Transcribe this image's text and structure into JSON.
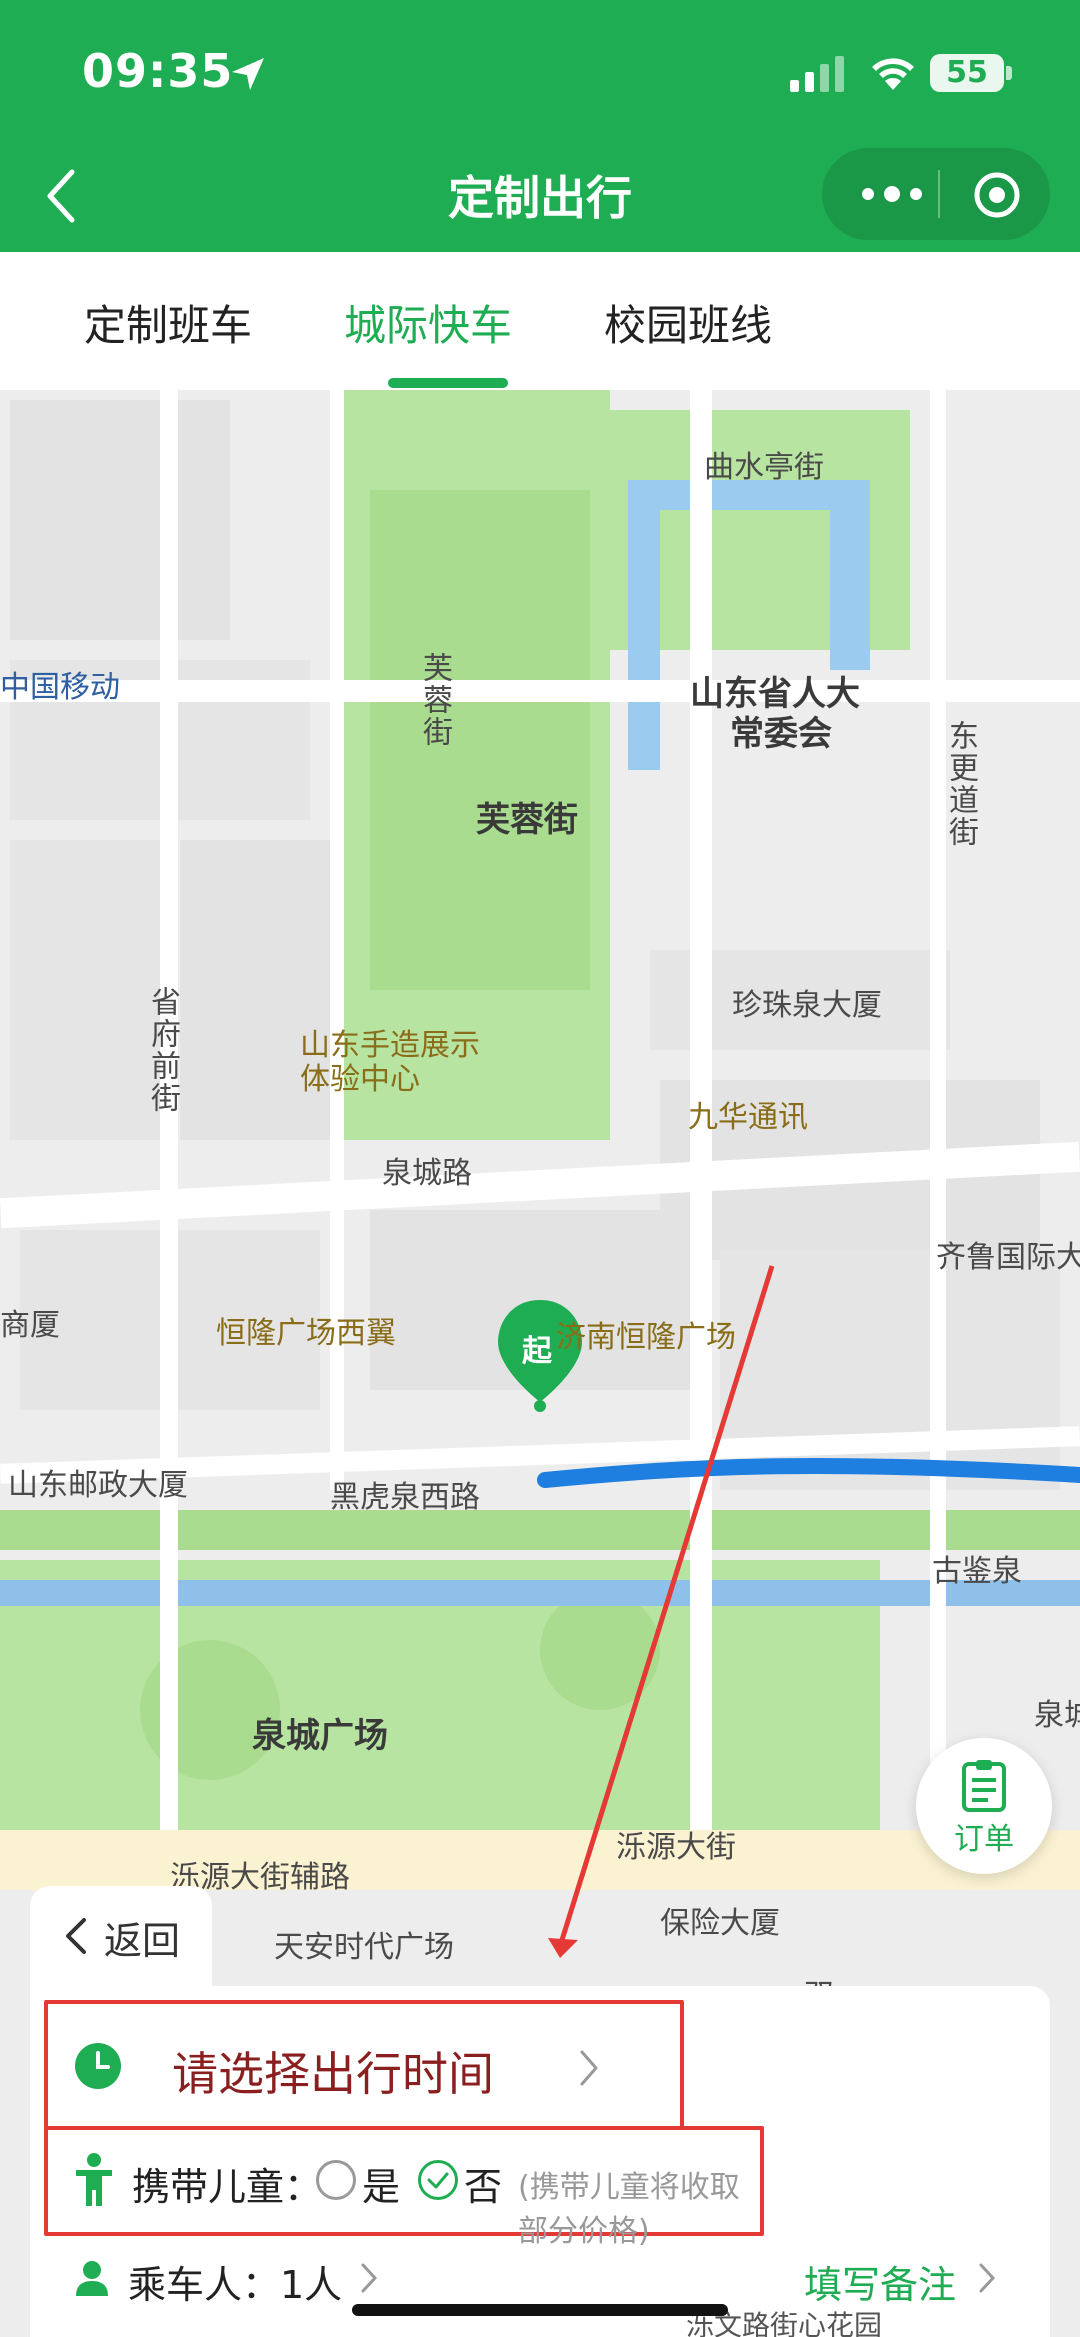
{
  "status_bar": {
    "time": "09:35",
    "battery": "55"
  },
  "nav": {
    "title": "定制出行"
  },
  "tabs": [
    {
      "label": "定制班车",
      "active": false
    },
    {
      "label": "城际快车",
      "active": true
    },
    {
      "label": "校园班线",
      "active": false
    }
  ],
  "map": {
    "labels": {
      "qushui": "曲水亭街",
      "renda": "山东省人大",
      "changwei": "常委会",
      "furong_big": "芙蓉街",
      "furong_vert": "芙蓉街",
      "dongeng": "东更道街",
      "mobile": "中国移动",
      "zhenzhu": "珍珠泉大厦",
      "shengfu": "省府前街",
      "shouzao1": "山东手造展示",
      "shouzao2": "体验中心",
      "jiuhua": "九华通讯",
      "quancheng_rd": "泉城路",
      "qilu": "齐鲁国际大",
      "henglong_w": "恒隆广场西翼",
      "henglong": "济南恒隆广场",
      "shangxia": "商厦",
      "youzheng": "山东邮政大厦",
      "heihu": "黑虎泉西路",
      "gujian": "古鉴泉",
      "quancheng_sq": "泉城广场",
      "quancheng_r": "泉城",
      "luoyuan": "泺源大街",
      "luoyuan_fu": "泺源大街辅路",
      "tianan": "天安时代广场",
      "baoxian": "保险大厦",
      "shuang": "双"
    },
    "start_marker": "起",
    "route_color": "#1e7fe0"
  },
  "order_button": {
    "label": "订单",
    "icon": "order-list-icon"
  },
  "sheet": {
    "back_label": "返回",
    "time_placeholder": "请选择出行时间",
    "kids_label": "携带儿童：",
    "option_yes": "是",
    "option_no": "否",
    "kids_selected": "否",
    "kids_note": "(携带儿童将收取部分价格)",
    "passenger_label": "乘车人：1人",
    "remark_label": "填写备注"
  },
  "bottom_street": "泺文路街心花园",
  "colors": {
    "brand": "#1ead52",
    "highlight": "#e53935",
    "accent_text": "#8b1e1e"
  }
}
